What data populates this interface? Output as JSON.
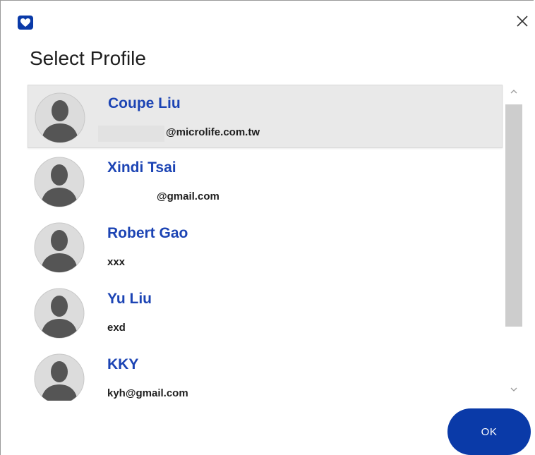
{
  "window": {
    "logo_icon": "heart-icon",
    "close_icon": "close-icon",
    "title": "Select Profile"
  },
  "profiles": [
    {
      "name": "Coupe Liu",
      "email": "@microlife.com.tw",
      "selected": true
    },
    {
      "name": "Xindi Tsai",
      "email": "@gmail.com",
      "selected": false
    },
    {
      "name": "Robert Gao",
      "email": "xxx",
      "selected": false
    },
    {
      "name": "Yu Liu",
      "email": "exd",
      "selected": false
    },
    {
      "name": "KKY",
      "email": "kyh@gmail.com",
      "selected": false
    }
  ],
  "buttons": {
    "ok_label": "OK"
  },
  "colors": {
    "accent": "#0a3aa8",
    "name_text": "#1c44b4",
    "selected_row": "#e9e9e9"
  }
}
